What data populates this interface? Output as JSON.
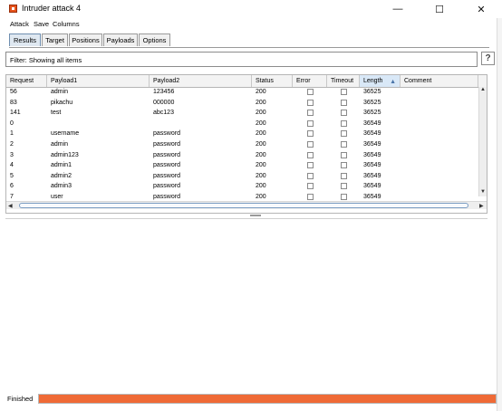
{
  "window": {
    "title": "Intruder attack 4",
    "controls": {
      "minimize": "—",
      "maximize": "☐",
      "close": "✕"
    }
  },
  "menu": [
    "Attack",
    "Save",
    "Columns"
  ],
  "tabs": [
    {
      "label": "Results",
      "active": true
    },
    {
      "label": "Target",
      "active": false
    },
    {
      "label": "Positions",
      "active": false
    },
    {
      "label": "Payloads",
      "active": false
    },
    {
      "label": "Options",
      "active": false
    }
  ],
  "filter": {
    "text": "Filter: Showing all items",
    "help_label": "?"
  },
  "table": {
    "columns": [
      "Request",
      "Payload1",
      "Payload2",
      "Status",
      "Error",
      "Timeout",
      "Length",
      "Comment"
    ],
    "sorted_column": "Length",
    "sort_arrow": "▲",
    "rows": [
      {
        "request": "56",
        "payload1": "admin",
        "payload2": "123456",
        "status": "200",
        "error": false,
        "timeout": false,
        "length": "36525",
        "comment": ""
      },
      {
        "request": "83",
        "payload1": "pikachu",
        "payload2": "000000",
        "status": "200",
        "error": false,
        "timeout": false,
        "length": "36525",
        "comment": ""
      },
      {
        "request": "141",
        "payload1": "test",
        "payload2": "abc123",
        "status": "200",
        "error": false,
        "timeout": false,
        "length": "36525",
        "comment": ""
      },
      {
        "request": "0",
        "payload1": "",
        "payload2": "",
        "status": "200",
        "error": false,
        "timeout": false,
        "length": "36549",
        "comment": ""
      },
      {
        "request": "1",
        "payload1": "username",
        "payload2": "password",
        "status": "200",
        "error": false,
        "timeout": false,
        "length": "36549",
        "comment": ""
      },
      {
        "request": "2",
        "payload1": "admin",
        "payload2": "password",
        "status": "200",
        "error": false,
        "timeout": false,
        "length": "36549",
        "comment": ""
      },
      {
        "request": "3",
        "payload1": "admin123",
        "payload2": "password",
        "status": "200",
        "error": false,
        "timeout": false,
        "length": "36549",
        "comment": ""
      },
      {
        "request": "4",
        "payload1": "admin1",
        "payload2": "password",
        "status": "200",
        "error": false,
        "timeout": false,
        "length": "36549",
        "comment": ""
      },
      {
        "request": "5",
        "payload1": "admin2",
        "payload2": "password",
        "status": "200",
        "error": false,
        "timeout": false,
        "length": "36549",
        "comment": ""
      },
      {
        "request": "6",
        "payload1": "admin3",
        "payload2": "password",
        "status": "200",
        "error": false,
        "timeout": false,
        "length": "36549",
        "comment": ""
      },
      {
        "request": "7",
        "payload1": "user",
        "payload2": "password",
        "status": "200",
        "error": false,
        "timeout": false,
        "length": "36549",
        "comment": ""
      }
    ]
  },
  "status": {
    "label": "Finished",
    "progress": 1.0,
    "progress_color": "#ef6a36"
  },
  "icons": {
    "app": "burp-icon",
    "scroll_up": "▲",
    "scroll_down": "▼",
    "scroll_left": "◀",
    "scroll_right": "▶"
  }
}
